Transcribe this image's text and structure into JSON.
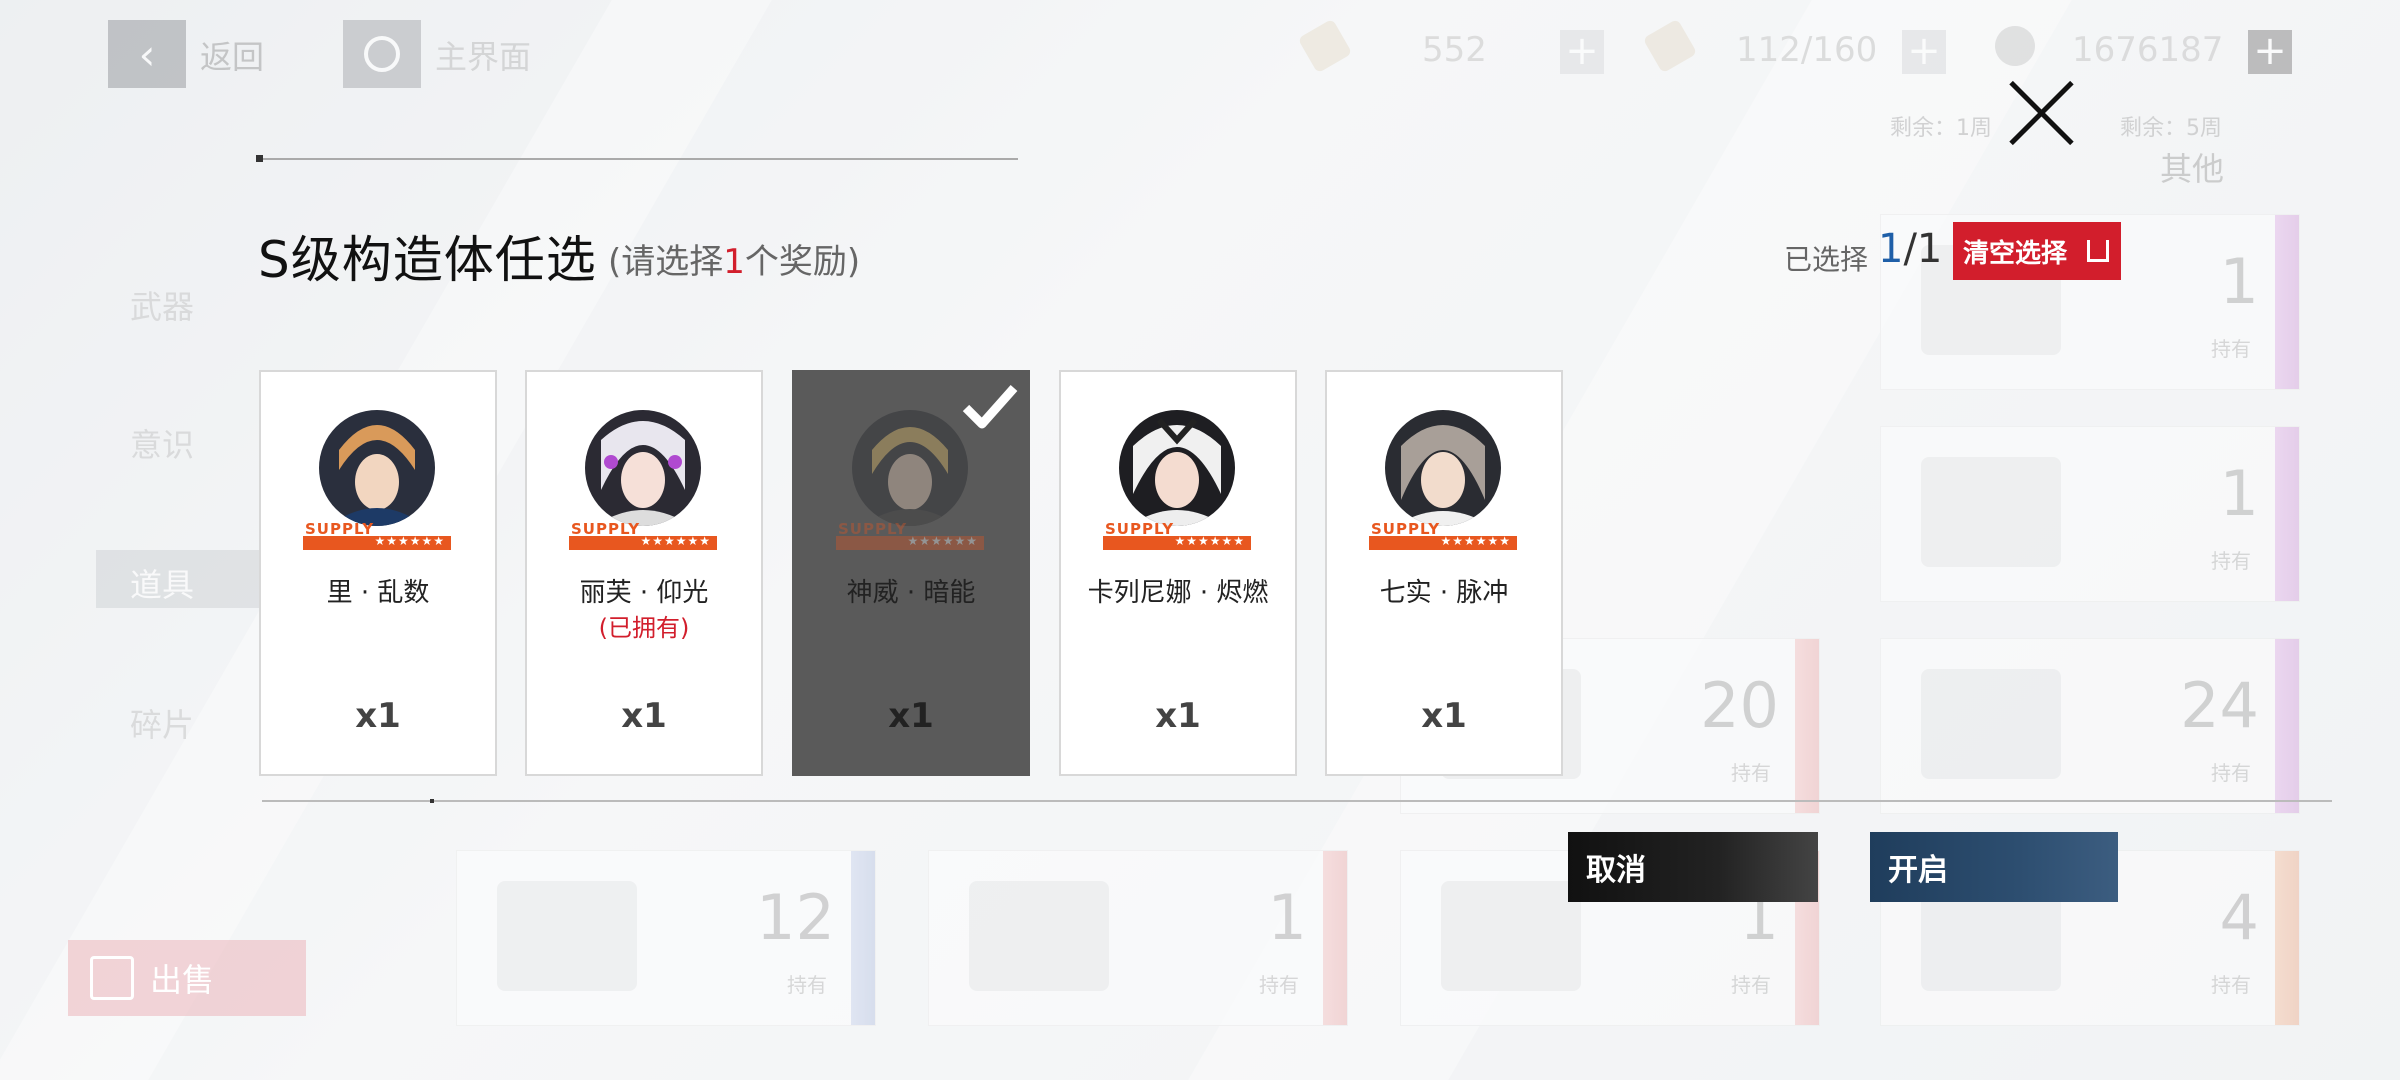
{
  "topbar": {
    "back_label": "返回",
    "home_label": "主界面",
    "res1": "552",
    "res2": "112/160",
    "res3": "1676187"
  },
  "background": {
    "sidebar": [
      "武器",
      "意识",
      "道具",
      "碎片"
    ],
    "sell_label": "出售",
    "remain1": "剩余：1周",
    "remain2": "剩余：5周",
    "filter_other": "其他",
    "hold_label": "持有",
    "card_counts": [
      "1",
      "1",
      "24",
      "4",
      "12",
      "20",
      "1",
      "1"
    ]
  },
  "dialog": {
    "title": "S级构造体任选",
    "subtitle_prefix": "(请选择",
    "subtitle_num": "1",
    "subtitle_suffix": "个奖励)",
    "selected_label": "已选择",
    "selected_cur": "1",
    "selected_total": "/1",
    "clear_label": "清空选择",
    "supply_text": "SUPPLY",
    "stars": "★★★★★★",
    "cards": [
      {
        "name": "里 · 乱数",
        "owned": "",
        "qty": "x1",
        "selected": false
      },
      {
        "name": "丽芙 · 仰光",
        "owned": "(已拥有)",
        "qty": "x1",
        "selected": false
      },
      {
        "name": "神威 · 暗能",
        "owned": "",
        "qty": "x1",
        "selected": true
      },
      {
        "name": "卡列尼娜 · 烬燃",
        "owned": "",
        "qty": "x1",
        "selected": false
      },
      {
        "name": "七实 · 脉冲",
        "owned": "",
        "qty": "x1",
        "selected": false
      }
    ],
    "cancel_label": "取消",
    "open_label": "开启"
  },
  "colors": {
    "accent_red": "#d21e2c",
    "accent_blue": "#1f5fa8",
    "supply_orange": "#e8571f",
    "open_button": "#2d4e70"
  }
}
